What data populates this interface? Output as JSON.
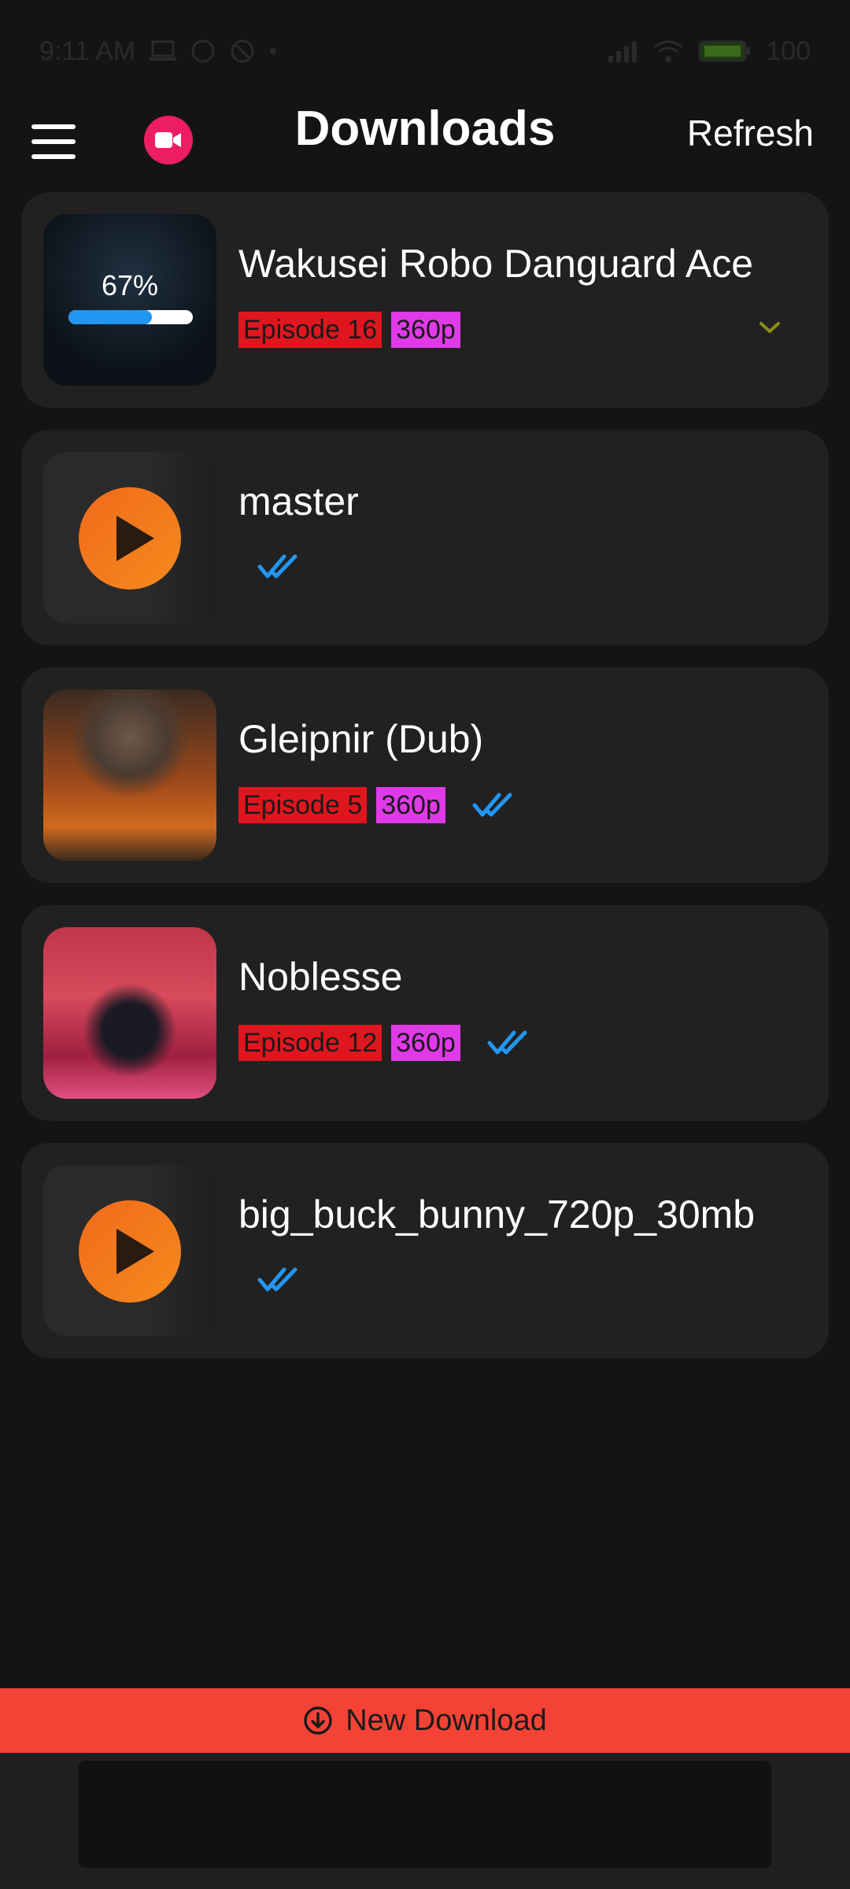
{
  "status_bar": {
    "time": "9:11 AM",
    "battery": "100"
  },
  "header": {
    "title": "Downloads",
    "refresh_label": "Refresh"
  },
  "downloads": [
    {
      "title": "Wakusei Robo Danguard Ace",
      "episode": "Episode 16",
      "quality": "360p",
      "progress_label": "67%",
      "progress": 0.67,
      "status": "downloading"
    },
    {
      "title": "master",
      "status": "completed"
    },
    {
      "title": "Gleipnir (Dub)",
      "episode": "Episode 5",
      "quality": "360p",
      "status": "completed"
    },
    {
      "title": "Noblesse",
      "episode": "Episode 12",
      "quality": "360p",
      "status": "completed"
    },
    {
      "title": "big_buck_bunny_720p_30mb",
      "status": "completed"
    }
  ],
  "footer": {
    "new_download_label": "New Download"
  },
  "colors": {
    "episode_tag": "#e0161e",
    "quality_tag": "#e03ae8",
    "progress": "#2196f3",
    "accent_button": "#f44336",
    "record": "#ec1d63",
    "check": "#2196f3"
  }
}
